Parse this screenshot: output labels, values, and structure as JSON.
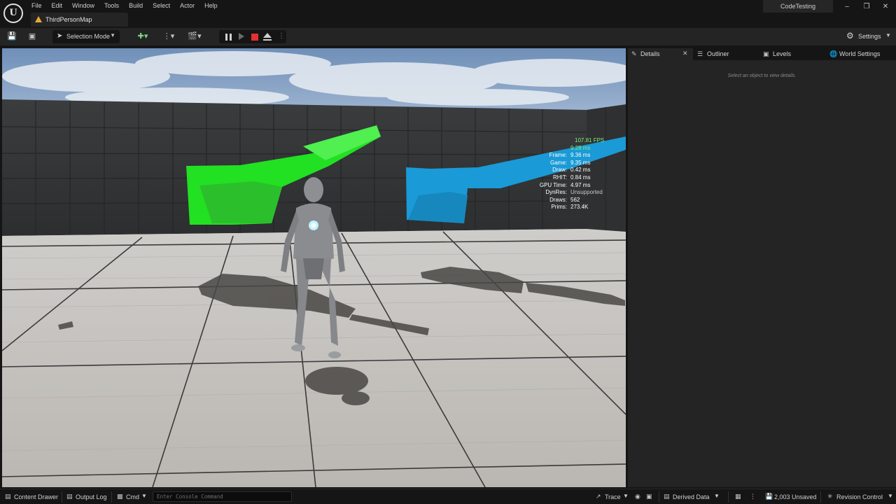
{
  "menu": [
    "File",
    "Edit",
    "Window",
    "Tools",
    "Build",
    "Select",
    "Actor",
    "Help"
  ],
  "map_tab": "ThirdPersonMap",
  "project_name": "CodeTesting",
  "toolbar": {
    "mode_label": "Selection Mode",
    "settings_label": "Settings"
  },
  "stats": {
    "fps": "107.81 FPS",
    "fps_ms": "9.28 ms",
    "rows": [
      {
        "key": "Frame:",
        "value": "9.36 ms"
      },
      {
        "key": "Game:",
        "value": "9.35 ms"
      },
      {
        "key": "Draw:",
        "value": "0.42 ms"
      },
      {
        "key": "RHIT:",
        "value": "0.84 ms"
      },
      {
        "key": "GPU Time:",
        "value": "4.97 ms"
      },
      {
        "key": "DynRes:",
        "value": "Unsupported"
      },
      {
        "key": "Draws:",
        "value": "562"
      },
      {
        "key": "Prims:",
        "value": "273.4K"
      }
    ]
  },
  "right_panel": {
    "tabs": [
      "Details",
      "Outliner",
      "Levels",
      "World Settings"
    ],
    "details_hint": "Select an object to view details."
  },
  "statusbar": {
    "content_drawer": "Content Drawer",
    "output_log": "Output Log",
    "cmd": "Cmd",
    "console_placeholder": "Enter Console Command",
    "trace": "Trace",
    "derived_data": "Derived Data",
    "unsaved": "2,003 Unsaved",
    "revision_control": "Revision Control"
  },
  "colors": {
    "green_arrow": "#22e022",
    "blue_arrow": "#1a9ad6",
    "stop_red": "#e53030",
    "map_tab_icon": "#e8a838"
  }
}
